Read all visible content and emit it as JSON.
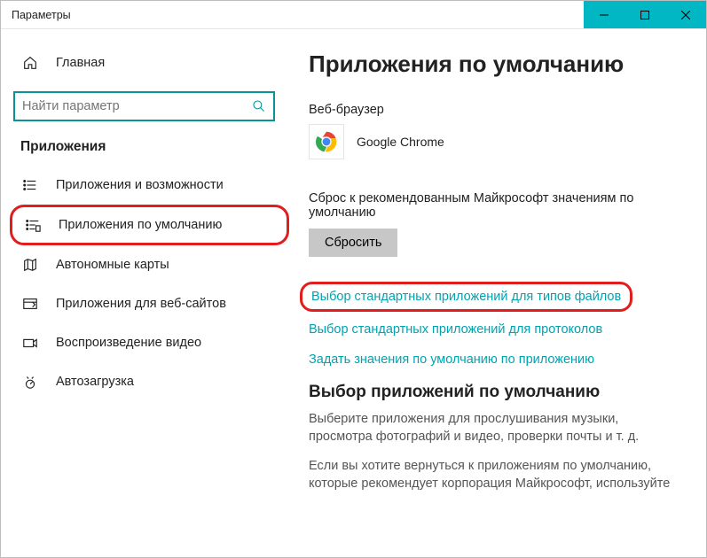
{
  "window": {
    "title": "Параметры"
  },
  "sidebar": {
    "home": "Главная",
    "search_placeholder": "Найти параметр",
    "section": "Приложения",
    "items": [
      {
        "label": "Приложения и возможности"
      },
      {
        "label": "Приложения по умолчанию"
      },
      {
        "label": "Автономные карты"
      },
      {
        "label": "Приложения для веб-сайтов"
      },
      {
        "label": "Воспроизведение видео"
      },
      {
        "label": "Автозагрузка"
      }
    ]
  },
  "main": {
    "heading": "Приложения по умолчанию",
    "browser_label": "Веб-браузер",
    "browser_app": "Google Chrome",
    "reset_desc": "Сброс к рекомендованным Майкрософт значениям по умолчанию",
    "reset_btn": "Сбросить",
    "link_filetypes": "Выбор стандартных приложений для типов файлов",
    "link_protocols": "Выбор стандартных приложений для протоколов",
    "link_byapp": "Задать значения по умолчанию по приложению",
    "subheading": "Выбор приложений по умолчанию",
    "para1": "Выберите приложения для прослушивания музыки, просмотра фотографий и видео, проверки почты и т. д.",
    "para2": "Если вы хотите вернуться к приложениям по умолчанию, которые рекомендует корпорация Майкрософт, используйте"
  }
}
